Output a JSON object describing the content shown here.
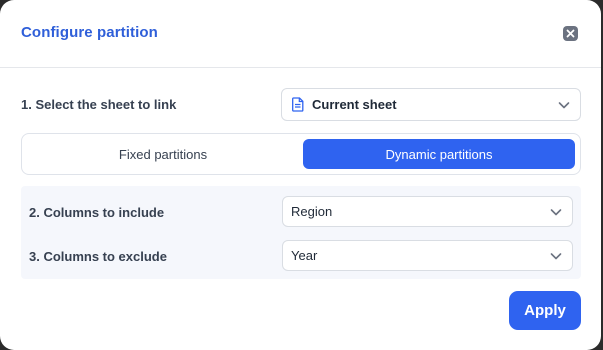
{
  "dialog": {
    "title": "Configure partition"
  },
  "icons": {
    "close": "close-icon",
    "sheet": "document-icon",
    "chevron": "chevron-down-icon"
  },
  "colors": {
    "accent": "#2f63f0",
    "title": "#2f5fd9",
    "section_bg": "#f5f7fc"
  },
  "step1": {
    "label": "1. Select the sheet to link",
    "selected": "Current sheet"
  },
  "partition_mode": {
    "options": [
      "Fixed partitions",
      "Dynamic partitions"
    ],
    "selected": "Dynamic partitions"
  },
  "step2": {
    "label": "2. Columns to include",
    "selected": "Region"
  },
  "step3": {
    "label": "3. Columns to exclude",
    "selected": "Year"
  },
  "footer": {
    "apply_label": "Apply"
  }
}
